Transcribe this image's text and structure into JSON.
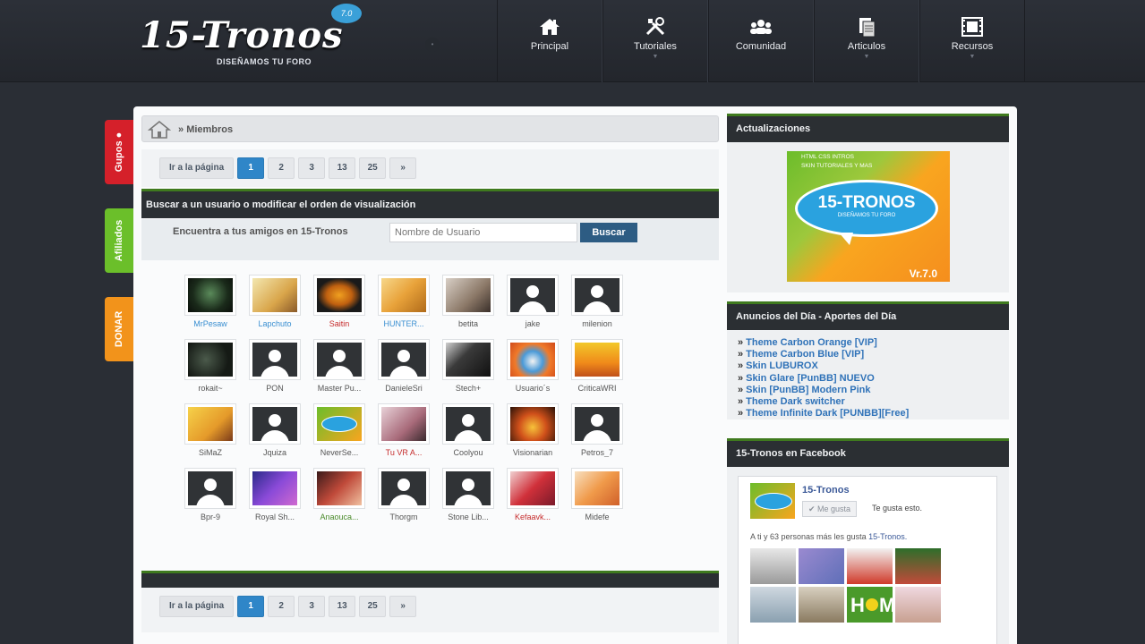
{
  "header": {
    "logo_text": "15-Tronos",
    "logo_badge": "7.0",
    "tagline": "DISEÑAMOS TU FORO",
    "nav": [
      {
        "label": "Principal",
        "icon": "home-icon",
        "caret": ""
      },
      {
        "label": "Tutoriales",
        "icon": "tools-icon",
        "caret": "▼"
      },
      {
        "label": "Comunidad",
        "icon": "community-icon",
        "caret": ""
      },
      {
        "label": "Articulos",
        "icon": "articles-icon",
        "caret": "▼"
      },
      {
        "label": "Recursos",
        "icon": "resources-icon",
        "caret": "▼"
      }
    ]
  },
  "side_tabs": {
    "grupos": "Gupos",
    "afiliados": "Afiliados",
    "donar": "DONAR"
  },
  "breadcrumb": {
    "separator": "»",
    "current": "Miembros"
  },
  "pagination": {
    "label": "Ir a la página",
    "pages": [
      "1",
      "2",
      "3",
      "13",
      "25"
    ],
    "current": "1",
    "next": "»"
  },
  "search": {
    "title": "Buscar a un usuario o modificar el orden de visualización",
    "label": "Encuentra a tus amigos en 15-Tronos",
    "placeholder": "Nombre de Usuario",
    "button": "Buscar"
  },
  "members": [
    {
      "name": "MrPesaw",
      "color": "blue",
      "avatar": "dark-figure"
    },
    {
      "name": "Lapchuto",
      "color": "blue",
      "avatar": "comic"
    },
    {
      "name": "Saitin",
      "color": "red",
      "avatar": "orange-mask"
    },
    {
      "name": "HUNTER...",
      "color": "blue",
      "avatar": "yellow-art"
    },
    {
      "name": "betita",
      "color": "default",
      "avatar": "portrait"
    },
    {
      "name": "jake",
      "color": "default",
      "avatar": "default"
    },
    {
      "name": "milenion",
      "color": "default",
      "avatar": "default"
    },
    {
      "name": "rokait~",
      "color": "default",
      "avatar": "dark-creature"
    },
    {
      "name": "PON",
      "color": "default",
      "avatar": "default"
    },
    {
      "name": "Master Pu...",
      "color": "default",
      "avatar": "default"
    },
    {
      "name": "DanieleSri",
      "color": "default",
      "avatar": "default"
    },
    {
      "name": "Stech+",
      "color": "default",
      "avatar": "dark-photo"
    },
    {
      "name": "Usuario´s",
      "color": "default",
      "avatar": "mask-face"
    },
    {
      "name": "CriticaWRI",
      "color": "default",
      "avatar": "sunglasses"
    },
    {
      "name": "SiMaZ",
      "color": "default",
      "avatar": "cartoon"
    },
    {
      "name": "Jquiza",
      "color": "default",
      "avatar": "default"
    },
    {
      "name": "NeverSe...",
      "color": "default",
      "avatar": "tronos-logo"
    },
    {
      "name": "Tu VR A...",
      "color": "red",
      "avatar": "girl"
    },
    {
      "name": "Coolyou",
      "color": "default",
      "avatar": "default"
    },
    {
      "name": "Visionarian",
      "color": "default",
      "avatar": "fire"
    },
    {
      "name": "Petros_7",
      "color": "default",
      "avatar": "default"
    },
    {
      "name": "Bpr-9",
      "color": "default",
      "avatar": "default"
    },
    {
      "name": "Royal Sh...",
      "color": "default",
      "avatar": "purple-art"
    },
    {
      "name": "Anaouca...",
      "color": "green",
      "avatar": "woman"
    },
    {
      "name": "Thorgm",
      "color": "default",
      "avatar": "default"
    },
    {
      "name": "Stone Lib...",
      "color": "default",
      "avatar": "default"
    },
    {
      "name": "Kefaavk...",
      "color": "red",
      "avatar": "anime-red"
    },
    {
      "name": "Midefe",
      "color": "default",
      "avatar": "anime-orange"
    }
  ],
  "sidebar": {
    "updates_title": "Actualizaciones",
    "promo": {
      "line1": "HTML CSS INTROS",
      "line2": "SKIN TUTORIALES Y MAS",
      "title": "15-TRONOS",
      "subtitle": "DISEÑAMOS TU FORO",
      "version": "Vr.7.0"
    },
    "ads_title": "Anuncios del Día - Aportes del Día",
    "ads": [
      "Theme Carbon Orange [VIP]",
      "Theme Carbon Blue [VIP]",
      "Skin LUBUROX",
      "Skin Glare [PunBB] NUEVO",
      "Skin [PunBB] Modern Pink",
      "Theme Dark switcher",
      "Theme Infinite Dark [PUNBB][Free]"
    ],
    "facebook_title": "15-Tronos en Facebook",
    "facebook": {
      "page_name": "15-Tronos",
      "like_button": "✔ Me gusta",
      "like_text": "Te gusta esto.",
      "count_text": "A ti y 63 personas más les gusta",
      "count_page": "15-Tronos."
    }
  },
  "colors": {
    "header_bg": "#262a30",
    "accent_green": "#3f7a1e",
    "link_blue": "#2f72b8",
    "pager_active": "#2f86c8",
    "tab_red": "#d5202a",
    "tab_green": "#6bbf2a",
    "tab_orange": "#f2931b"
  }
}
